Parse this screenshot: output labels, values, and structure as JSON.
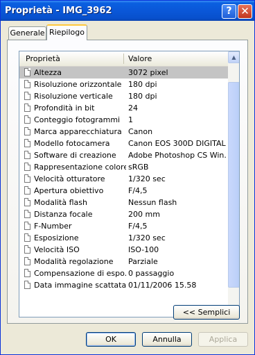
{
  "window": {
    "title": "Proprietà - IMG_3962"
  },
  "title_buttons": {
    "help": "?",
    "close": "✕"
  },
  "tabs": [
    {
      "label": "Generale"
    },
    {
      "label": "Riepilogo"
    }
  ],
  "list": {
    "columns": {
      "property": "Proprietà",
      "value": "Valore"
    },
    "rows": [
      {
        "name": "Altezza",
        "value": "3072 pixel"
      },
      {
        "name": "Risoluzione orizzontale",
        "value": "180 dpi"
      },
      {
        "name": "Risoluzione verticale",
        "value": "180 dpi"
      },
      {
        "name": "Profondità in bit",
        "value": "24"
      },
      {
        "name": "Conteggio fotogrammi",
        "value": "1"
      },
      {
        "name": "Marca apparecchiatura",
        "value": "Canon"
      },
      {
        "name": "Modello fotocamera",
        "value": "Canon EOS 300D DIGITAL"
      },
      {
        "name": "Software di creazione",
        "value": "Adobe Photoshop CS Win..."
      },
      {
        "name": "Rappresentazione colore",
        "value": "sRGB"
      },
      {
        "name": "Velocità otturatore",
        "value": "1/320 sec"
      },
      {
        "name": "Apertura obiettivo",
        "value": "F/4,5"
      },
      {
        "name": "Modalità flash",
        "value": "Nessun flash"
      },
      {
        "name": "Distanza focale",
        "value": "200 mm"
      },
      {
        "name": "F-Number",
        "value": "F/4,5"
      },
      {
        "name": "Esposizione",
        "value": "1/320 sec"
      },
      {
        "name": "Velocità ISO",
        "value": "ISO-100"
      },
      {
        "name": "Modalità regolazione",
        "value": "Parziale"
      },
      {
        "name": "Compensazione di espo...",
        "value": "0 passaggio"
      },
      {
        "name": "Data immagine scattata",
        "value": "01/11/2006 15.58"
      }
    ],
    "selected_row": "Altezza"
  },
  "buttons": {
    "semplici": "<< Semplici",
    "ok": "OK",
    "annulla": "Annulla",
    "applica": "Applica"
  },
  "colors": {
    "titlebar": "#0a57d8",
    "selection": "#c4c4c4",
    "tab_highlight": "#ffc83c"
  }
}
